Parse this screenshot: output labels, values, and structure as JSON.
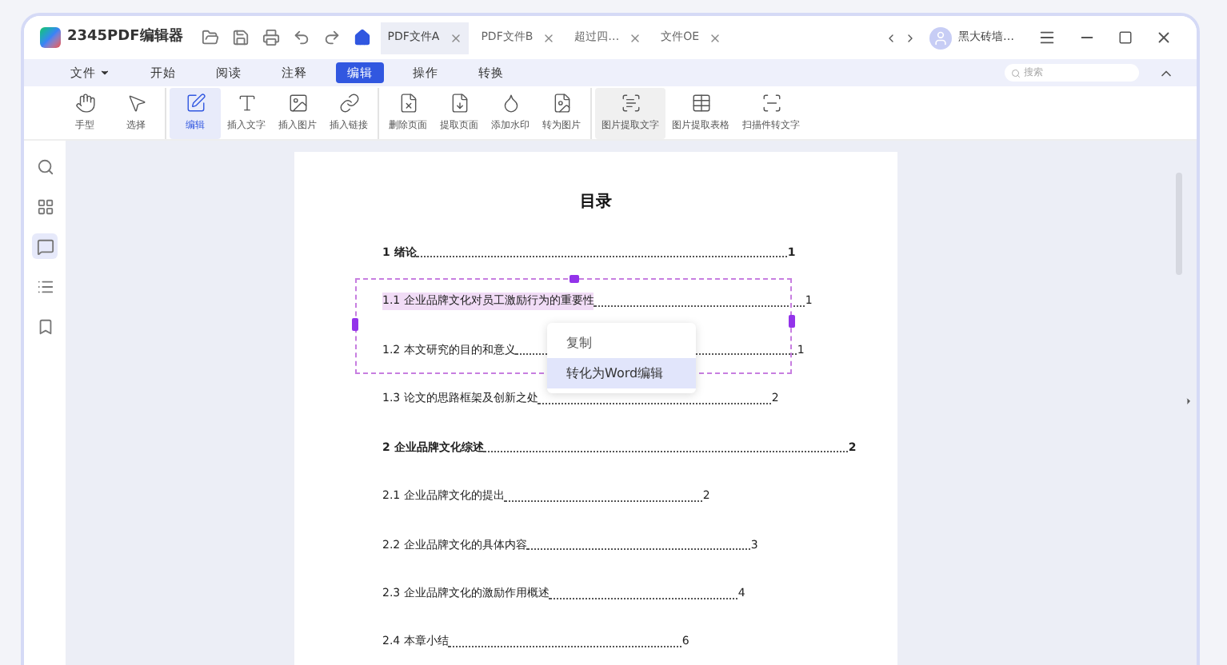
{
  "app": {
    "name": "2345PDF编辑器"
  },
  "tabs": [
    {
      "label": "PDF文件A",
      "selected": true
    },
    {
      "label": "PDF文件B",
      "selected": false
    },
    {
      "label": "超过四…",
      "selected": false
    },
    {
      "label": "文件OE",
      "selected": false
    }
  ],
  "user": {
    "name": "黑大砖墙…"
  },
  "menu": [
    {
      "label": "文件",
      "selected": false,
      "dropdown": true
    },
    {
      "label": "开始",
      "selected": false,
      "dropdown": false
    },
    {
      "label": "阅读",
      "selected": false,
      "dropdown": false
    },
    {
      "label": "注释",
      "selected": false,
      "dropdown": false
    },
    {
      "label": "编辑",
      "selected": true,
      "dropdown": false
    },
    {
      "label": "操作",
      "selected": false,
      "dropdown": false
    },
    {
      "label": "转换",
      "selected": false,
      "dropdown": false
    }
  ],
  "search": {
    "placeholder": "搜索"
  },
  "toolbar": [
    [
      {
        "label": "手型",
        "selected": false,
        "hovered": false
      },
      {
        "label": "选择",
        "selected": false,
        "hovered": false
      }
    ],
    [
      {
        "label": "编辑",
        "selected": true,
        "hovered": false
      },
      {
        "label": "插入文字",
        "selected": false,
        "hovered": false
      },
      {
        "label": "插入图片",
        "selected": false,
        "hovered": false
      },
      {
        "label": "插入链接",
        "selected": false,
        "hovered": false
      }
    ],
    [
      {
        "label": "删除页面",
        "selected": false,
        "hovered": false
      },
      {
        "label": "提取页面",
        "selected": false,
        "hovered": false
      },
      {
        "label": "添加水印",
        "selected": false,
        "hovered": false
      },
      {
        "label": "转为图片",
        "selected": false,
        "hovered": false
      }
    ],
    [
      {
        "label": "图片提取文字",
        "selected": false,
        "hovered": true
      },
      {
        "label": "图片提取表格",
        "selected": false,
        "hovered": false
      },
      {
        "label": "扫描件转文字",
        "selected": false,
        "hovered": false
      }
    ]
  ],
  "sidebar": [
    {
      "selected": false
    },
    {
      "selected": false
    },
    {
      "selected": true
    },
    {
      "selected": false
    },
    {
      "selected": false
    }
  ],
  "document": {
    "title": "目录",
    "entries": [
      {
        "number": "1",
        "text": "绪论",
        "page": "1",
        "bold": true,
        "highlighted": false
      },
      {
        "number": "1.1",
        "text": "企业品牌文化对员工激励行为的重要性",
        "page": "1",
        "bold": false,
        "highlighted": true
      },
      {
        "number": "1.2",
        "text": "本文研究的目的和意义",
        "page": "1",
        "bold": false,
        "highlighted": false
      },
      {
        "number": "1.3",
        "text": "论文的思路框架及创新之处",
        "page": "2",
        "bold": false,
        "highlighted": false
      },
      {
        "number": "2",
        "text": "企业品牌文化综述",
        "page": "2",
        "bold": true,
        "highlighted": false
      },
      {
        "number": "2.1",
        "text": "企业品牌文化的提出",
        "page": "2",
        "bold": false,
        "highlighted": false
      },
      {
        "number": "2.2",
        "text": "企业品牌文化的具体内容",
        "page": "3",
        "bold": false,
        "highlighted": false
      },
      {
        "number": "2.3",
        "text": "企业品牌文化的激励作用概述",
        "page": "4",
        "bold": false,
        "highlighted": false
      },
      {
        "number": "2.4",
        "text": "本章小结",
        "page": "6",
        "bold": false,
        "highlighted": false
      }
    ]
  },
  "context_menu": [
    {
      "label": "复制",
      "selected": false
    },
    {
      "label": "转化为Word编辑",
      "selected": true
    }
  ]
}
